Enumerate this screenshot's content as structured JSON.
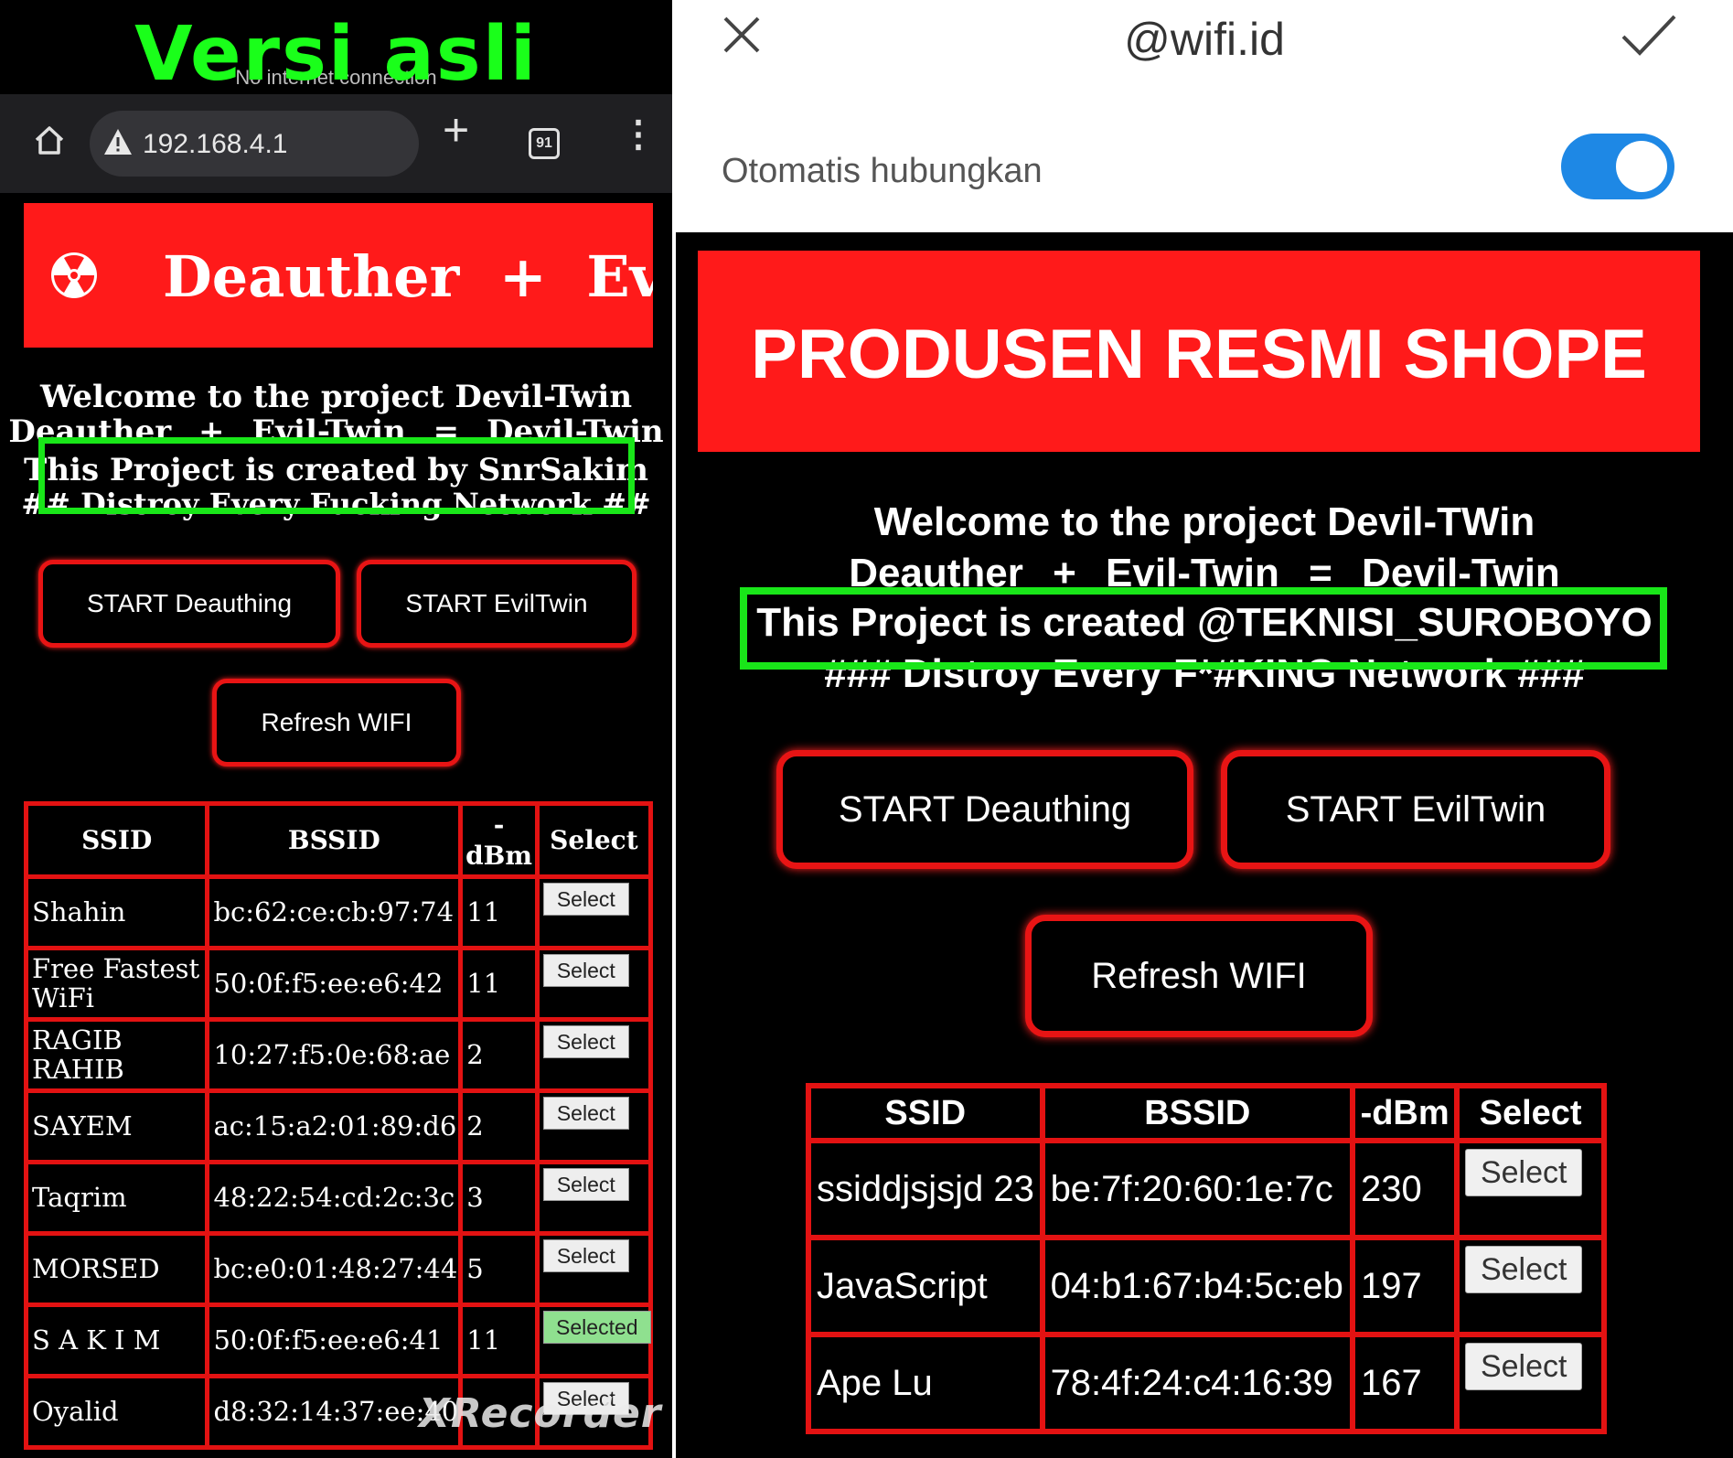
{
  "left": {
    "caption": "Versi asli",
    "status_bar": "No internet connection",
    "browser": {
      "url": "192.168.4.1",
      "tab_count": "91"
    },
    "banner_title": "Deauther + Evil-",
    "welcome": {
      "line1": "Welcome to the project Devil-Twin",
      "line2": "Deauther + Evil-Twin = Devil-Twin",
      "line3": "This Project is created by SnrSakim",
      "line4": "## Distroy Every Fucking Network ##"
    },
    "buttons": {
      "deauth": "START Deauthing",
      "eviltwin": "START EvilTwin",
      "refresh": "Refresh WIFI"
    },
    "table": {
      "headers": [
        "SSID",
        "BSSID",
        "-\ndBm",
        "Select"
      ],
      "rows": [
        {
          "ssid": "Shahin",
          "bssid": "bc:62:ce:cb:97:74",
          "dbm": "11",
          "select": "Select",
          "selected": false
        },
        {
          "ssid": "Free Fastest WiFi",
          "bssid": "50:0f:f5:ee:e6:42",
          "dbm": "11",
          "select": "Select",
          "selected": false
        },
        {
          "ssid": "RAGIB RAHIB",
          "bssid": "10:27:f5:0e:68:ae",
          "dbm": "2",
          "select": "Select",
          "selected": false
        },
        {
          "ssid": "SAYEM",
          "bssid": "ac:15:a2:01:89:d6",
          "dbm": "2",
          "select": "Select",
          "selected": false
        },
        {
          "ssid": "Taqrim",
          "bssid": "48:22:54:cd:2c:3c",
          "dbm": "3",
          "select": "Select",
          "selected": false
        },
        {
          "ssid": "MORSED",
          "bssid": "bc:e0:01:48:27:44",
          "dbm": "5",
          "select": "Select",
          "selected": false
        },
        {
          "ssid": "S A K I M",
          "bssid": "50:0f:f5:ee:e6:41",
          "dbm": "11",
          "select": "Selected",
          "selected": true
        },
        {
          "ssid": "Oyalid",
          "bssid": "d8:32:14:37:ee:40",
          "dbm": "",
          "select": "Select",
          "selected": false
        }
      ]
    },
    "watermark": "XRecorder"
  },
  "right": {
    "network_name": "@wifi.id",
    "auto_connect_label": "Otomatis hubungkan",
    "auto_connect_on": true,
    "banner_title": "PRODUSEN RESMI SHOPE",
    "welcome": {
      "line1": "Welcome to the project Devil-TWin",
      "line2": "Deauther + Evil-Twin = Devil-Twin",
      "line3": "This Project is created @TEKNISI_SUROBOYO",
      "line4": "### Distroy Every F*#KING Network ###"
    },
    "buttons": {
      "deauth": "START Deauthing",
      "eviltwin": "START EvilTwin",
      "refresh": "Refresh WIFI"
    },
    "table": {
      "headers": [
        "SSID",
        "BSSID",
        "-dBm",
        "Select"
      ],
      "rows": [
        {
          "ssid": "ssiddjsjsjd 23",
          "bssid": "be:7f:20:60:1e:7c",
          "dbm": "230",
          "select": "Select"
        },
        {
          "ssid": "JavaScript",
          "bssid": "04:b1:67:b4:5c:eb",
          "dbm": "197",
          "select": "Select"
        },
        {
          "ssid": "Ape Lu",
          "bssid": "78:4f:24:c4:16:39",
          "dbm": "167",
          "select": "Select"
        }
      ]
    }
  },
  "colors": {
    "banner_red": "#ff1a1a",
    "border_red": "#e31212",
    "highlight_green": "#19e619",
    "toggle_blue": "#1e88e5",
    "selected_green": "#8fe08f"
  }
}
